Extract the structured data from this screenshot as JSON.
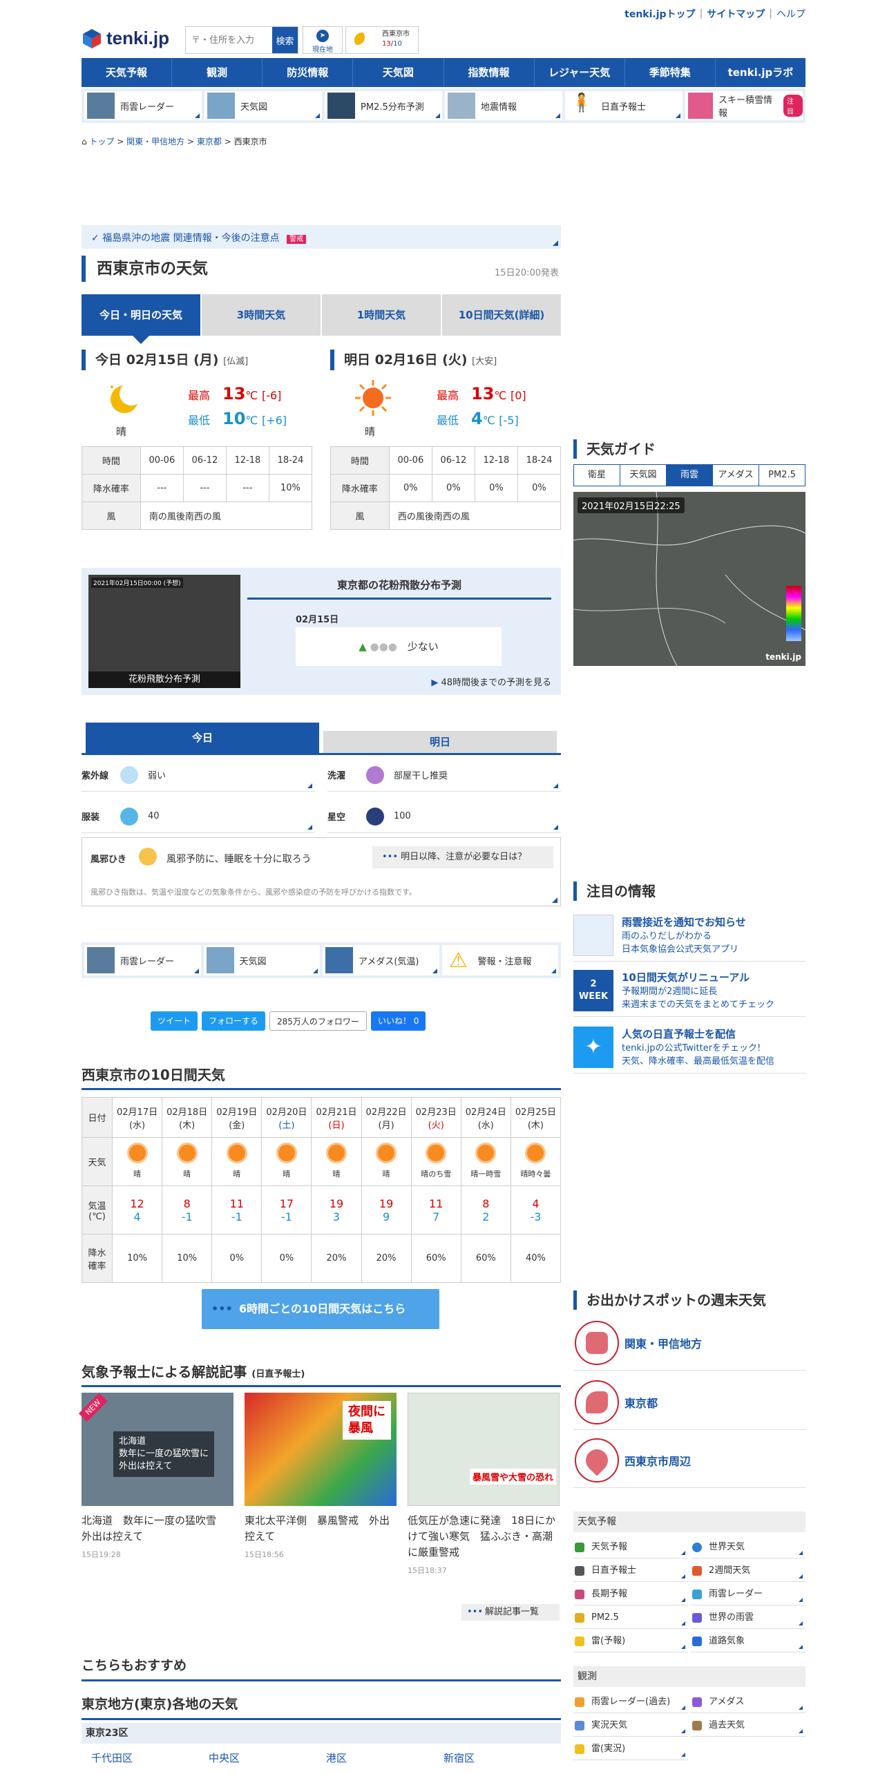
{
  "header": {
    "links": [
      "tenki.jpトップ",
      "サイトマップ",
      "ヘルプ"
    ],
    "logo_text": "tenki.jp",
    "search_placeholder": "〒・住所を入力",
    "search_button": "検索",
    "current_location": "現在地",
    "mini_city": "西東京市",
    "mini_high": "13",
    "mini_low": "10"
  },
  "nav": [
    "天気予報",
    "観測",
    "防災情報",
    "天気図",
    "指数情報",
    "レジャー天気",
    "季節特集",
    "tenki.jpラボ"
  ],
  "subnav": [
    "雨雲レーダー",
    "天気図",
    "PM2.5分布予測",
    "地震情報",
    "日直予報士",
    "スキー積雪情報"
  ],
  "subnav_badge": "注目",
  "breadcrumb": [
    "トップ",
    "関東・甲信地方",
    "東京都",
    "西東京市"
  ],
  "notice": {
    "text": "福島県沖の地震 関連情報・今後の注意点",
    "tag": "警戒"
  },
  "page_title": "西東京市の天気",
  "issued": "15日20:00発表",
  "tabs": [
    "今日・明日の天気",
    "3時間天気",
    "1時間天気",
    "10日間天気(詳細)"
  ],
  "today": {
    "title": "今日 02月15日 (月)",
    "rokuyo": "[仏滅]",
    "weather": "晴",
    "high_label": "最高",
    "high": "13",
    "high_diff": "[-6]",
    "low_label": "最低",
    "low": "10",
    "low_diff": "[+6]",
    "unit": "℃",
    "headers": [
      "時間",
      "00-06",
      "06-12",
      "12-18",
      "18-24"
    ],
    "rain_label": "降水確率",
    "rain": [
      "---",
      "---",
      "---",
      "10%"
    ],
    "wind_label": "風",
    "wind": "南の風後南西の風"
  },
  "tomorrow": {
    "title": "明日 02月16日 (火)",
    "rokuyo": "[大安]",
    "weather": "晴",
    "high_label": "最高",
    "high": "13",
    "high_diff": "[0]",
    "low_label": "最低",
    "low": "4",
    "low_diff": "[-5]",
    "unit": "℃",
    "headers": [
      "時間",
      "00-06",
      "06-12",
      "12-18",
      "18-24"
    ],
    "rain_label": "降水確率",
    "rain": [
      "0%",
      "0%",
      "0%",
      "0%"
    ],
    "wind_label": "風",
    "wind": "西の風後南西の風"
  },
  "pollen": {
    "map_date": "2021年02月15日00:00 (予想)",
    "map_caption": "花粉飛散分布予測",
    "title": "東京都の花粉飛散分布予測",
    "date": "02月15日",
    "level": "少ない",
    "more": "48時間後までの予測を見る"
  },
  "index_tabs": [
    "今日",
    "明日"
  ],
  "indices": [
    {
      "label": "紫外線",
      "value": "弱い"
    },
    {
      "label": "洗濯",
      "value": "部屋干し推奨"
    },
    {
      "label": "服装",
      "value": "40"
    },
    {
      "label": "星空",
      "value": "100"
    }
  ],
  "cold": {
    "label": "風邪ひき",
    "text": "風邪予防に、睡眠を十分に取ろう",
    "button": "明日以降、注意が必要な日は？",
    "note": "風邪ひき指数は、気温や湿度などの気象条件から、風邪や感染症の予防を呼びかける指数です。"
  },
  "bottomnav": [
    "雨雲レーダー",
    "天気図",
    "アメダス(気温)",
    "警報・注意報"
  ],
  "social": [
    "ツイート",
    "フォローする",
    "285万人のフォロワー",
    "いいね！ 0"
  ],
  "ten_day": {
    "title": "西東京市の10日間天気",
    "row_labels": [
      "日付",
      "天気",
      "気温\n(℃)",
      "降水\n確率"
    ],
    "days": [
      {
        "date": "02月17日",
        "dow": "(水)",
        "weather": "晴",
        "max": "12",
        "min": "4",
        "rain": "10%"
      },
      {
        "date": "02月18日",
        "dow": "(木)",
        "weather": "晴",
        "max": "8",
        "min": "-1",
        "rain": "10%"
      },
      {
        "date": "02月19日",
        "dow": "(金)",
        "weather": "晴",
        "max": "11",
        "min": "-1",
        "rain": "0%"
      },
      {
        "date": "02月20日",
        "dow": "(土)",
        "weather": "晴",
        "max": "17",
        "min": "-1",
        "rain": "0%"
      },
      {
        "date": "02月21日",
        "dow": "(日)",
        "weather": "晴",
        "max": "19",
        "min": "3",
        "rain": "20%"
      },
      {
        "date": "02月22日",
        "dow": "(月)",
        "weather": "晴",
        "max": "19",
        "min": "9",
        "rain": "20%"
      },
      {
        "date": "02月23日",
        "dow": "(火)",
        "weather": "晴のち雪",
        "max": "11",
        "min": "7",
        "rain": "60%"
      },
      {
        "date": "02月24日",
        "dow": "(水)",
        "weather": "晴一時雪",
        "max": "8",
        "min": "2",
        "rain": "60%"
      },
      {
        "date": "02月25日",
        "dow": "(木)",
        "weather": "晴時々曇",
        "max": "4",
        "min": "-3",
        "rain": "40%"
      }
    ],
    "button": "6時間ごとの10日間天気はこちら"
  },
  "articles": {
    "title": "気象予報士による解説記事",
    "subtitle": "(日直予報士)",
    "items": [
      {
        "title": "北海道　数年に一度の猛吹雪　外出は控えて",
        "date": "15日19:28",
        "overlay": "北海道\n数年に一度の猛吹雪に\n外出は控えて",
        "badge": "NEW"
      },
      {
        "title": "東北太平洋側　暴風警戒　外出控えて",
        "date": "15日18:56",
        "overlay": "夜間に\n暴風"
      },
      {
        "title": "低気圧が急速に発達　18日にかけて強い寒気　猛ふぶき・高潮に厳重警戒",
        "date": "15日18:37",
        "overlay": "暴風雪や大雪の恐れ"
      }
    ],
    "list_button": "解説記事一覧"
  },
  "recommend": "こちらもおすすめ",
  "region": {
    "title": "東京地方(東京)各地の天気",
    "sub": "東京23区",
    "wards": [
      "千代田区",
      "中央区",
      "港区",
      "新宿区"
    ]
  },
  "guide": {
    "title": "天気ガイド",
    "tabs": [
      "衛星",
      "天気図",
      "雨雲",
      "アメダス",
      "PM2.5"
    ],
    "radar_time": "2021年02月15日22:25",
    "logo": "tenki.jp"
  },
  "notices": {
    "title": "注目の情報",
    "items": [
      {
        "title": "雨雲接近を通知でお知らせ",
        "sub": "雨のふりだしがわかる\n日本気象協会公式天気アプリ"
      },
      {
        "title": "10日間天気がリニューアル",
        "sub": "予報期間が2週間に延長\n来週末までの天気をまとめてチェック",
        "icon_text": "2\nWEEK"
      },
      {
        "title": "人気の日直予報士を配信",
        "sub": "tenki.jpの公式Twitterをチェック!\n天気、降水確率、最高最低気温を配信"
      }
    ]
  },
  "spots": {
    "title": "お出かけスポットの週末天気",
    "items": [
      "関東・甲信地方",
      "東京都",
      "西東京市周辺"
    ]
  },
  "forecast_links": {
    "title": "天気予報",
    "items": [
      "天気予報",
      "世界天気",
      "日直予報士",
      "2週間天気",
      "長期予報",
      "雨雲レーダー",
      "PM2.5",
      "世界の雨雲",
      "雷(予報)",
      "道路気象"
    ]
  },
  "obs_links": {
    "title": "観測",
    "items": [
      "雨雲レーダー(過去)",
      "アメダス",
      "実況天気",
      "過去天気",
      "雷(実況)"
    ]
  }
}
